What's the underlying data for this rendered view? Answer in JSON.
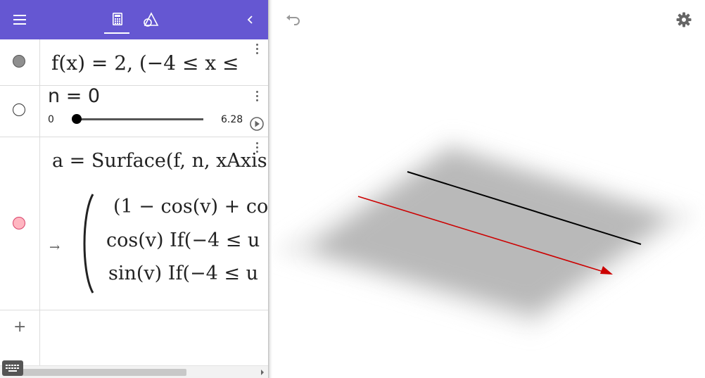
{
  "algebra": {
    "rows": [
      {
        "marble_color": "#8f8f8f",
        "text": "f(x)  =  2,     (−4 ≤ x ≤"
      },
      {
        "marble_color": "#ffffff",
        "text": "n = 0",
        "slider": {
          "min": "0",
          "max": "6.28",
          "value": 0
        }
      },
      {
        "marble_color": "#ffb6c1",
        "definition": "a = Surface(f, n, xAxis",
        "arrow": "→",
        "result_lines": [
          "(1 − cos(v) + co",
          "cos(v) If(−4 ≤ u",
          "sin(v) If(−4 ≤ u"
        ]
      }
    ],
    "new_input_symbol": "+"
  },
  "colors": {
    "toolbar": "#6557d2",
    "surface": "#b9b9b9",
    "function_line": "#000000",
    "x_axis": "#cc0000",
    "accent": "#6557d2"
  },
  "icons": {
    "menu": "menu-icon",
    "algebra_tab": "calculator-icon",
    "tools_tab": "geometry-tools-icon",
    "collapse": "chevron-left-icon",
    "undo": "undo-icon",
    "settings": "gear-icon",
    "keyboard": "keyboard-icon",
    "play": "play-icon",
    "more": "more-vertical-icon"
  }
}
